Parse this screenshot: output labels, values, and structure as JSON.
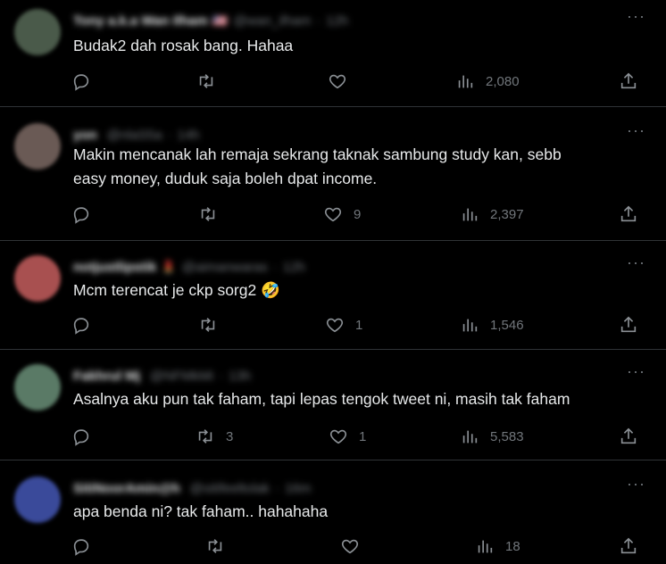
{
  "tweets": [
    {
      "name": "Tony a.k.a Wan Ilham",
      "handle": "@wan_ilham",
      "time": "12h",
      "flag": "🇺🇸",
      "text": "Budak2 dah rosak bang. Hahaa",
      "replies": "",
      "retweets": "",
      "likes": "",
      "views": "2,080",
      "avatar_color": "#4a5a4a"
    },
    {
      "name": "yon",
      "handle": "@nlaS5a",
      "time": "14h",
      "flag": "",
      "text": "Makin mencanak lah remaja sekrang taknak sambung study kan, sebb\neasy money, duduk saja boleh dpat income.",
      "replies": "",
      "retweets": "",
      "likes": "9",
      "views": "2,397",
      "avatar_color": "#6a5a55"
    },
    {
      "name": "notjustlipstik",
      "handle": "@aimanwaras",
      "time": "12h",
      "flag": "💄",
      "text": "Mcm terencat je ckp sorg2 🤣",
      "replies": "",
      "retweets": "",
      "likes": "1",
      "views": "1,546",
      "avatar_color": "#a85050"
    },
    {
      "name": "Fakhrul Mj",
      "handle": "@NFMkMi",
      "time": "13h",
      "flag": "",
      "text": "Asalnya aku pun tak faham, tapi lepas tengok tweet ni, masih tak faham",
      "replies": "",
      "retweets": "3",
      "likes": "1",
      "views": "5,583",
      "avatar_color": "#5a7a66"
    },
    {
      "name": "SitiNoorAmin@h",
      "handle": "@sitifeeltolak",
      "time": "16m",
      "flag": "",
      "text": "apa benda ni? tak faham.. hahahaha",
      "replies": "",
      "retweets": "",
      "likes": "",
      "views": "18",
      "avatar_color": "#3a4a9a"
    }
  ],
  "colors": {
    "background": "#000000",
    "text": "#e7e9ea",
    "muted": "#71767b",
    "divider": "#2f3336"
  },
  "icons": {
    "reply": "reply-icon",
    "retweet": "retweet-icon",
    "like": "heart-icon",
    "views": "views-icon",
    "share": "share-icon",
    "more": "more-icon"
  }
}
